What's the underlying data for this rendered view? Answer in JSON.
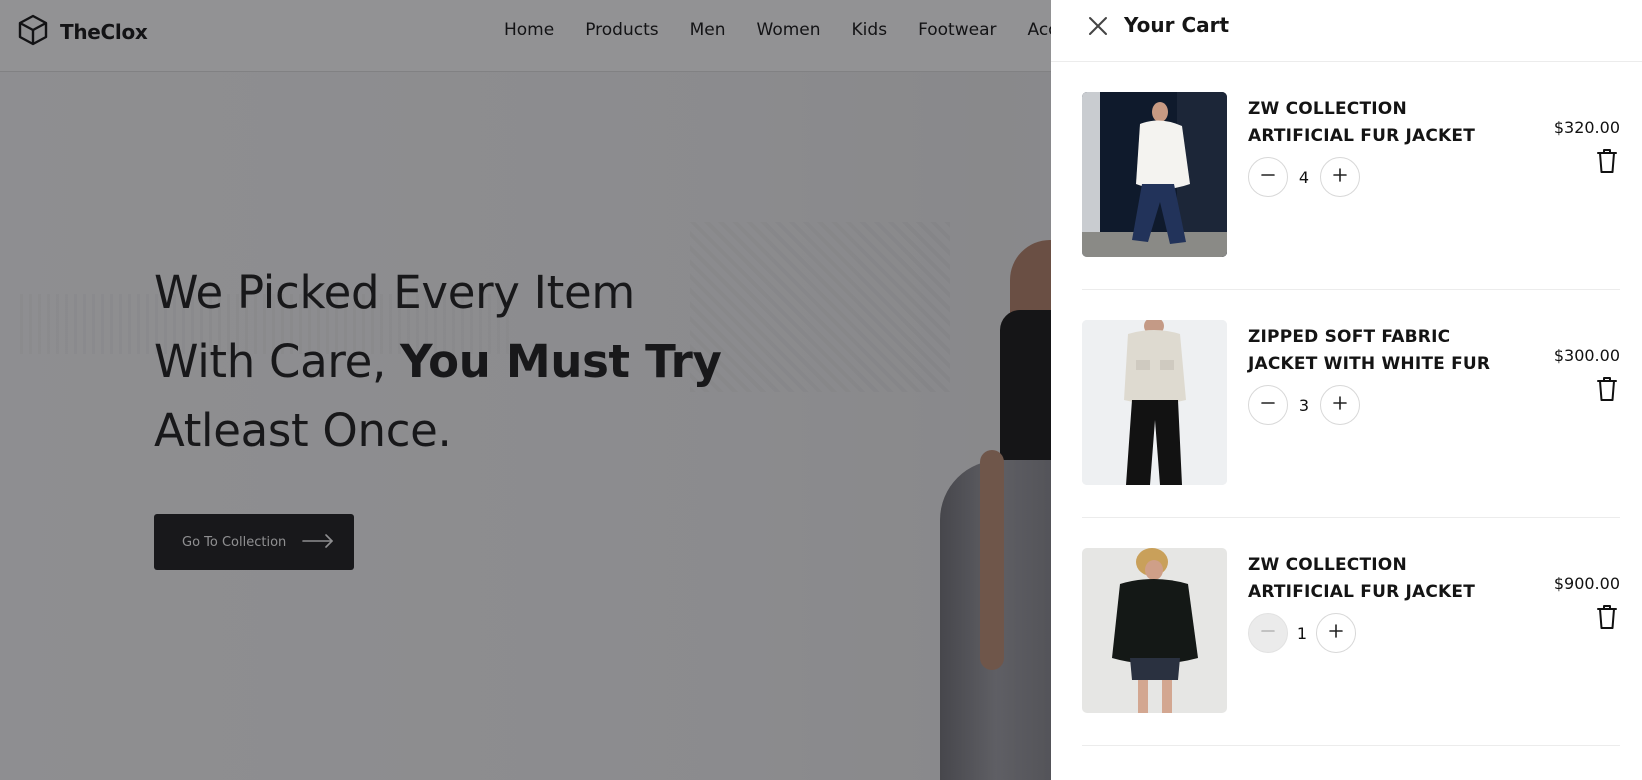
{
  "brand": {
    "name": "TheClox",
    "logo_icon": "cube-icon"
  },
  "nav": {
    "items": [
      {
        "label": "Home"
      },
      {
        "label": "Products"
      },
      {
        "label": "Men"
      },
      {
        "label": "Women"
      },
      {
        "label": "Kids"
      },
      {
        "label": "Footwear"
      },
      {
        "label": "Acc"
      }
    ]
  },
  "hero": {
    "title_line1": "We Picked Every Item",
    "title_line2_regular": "With Care, ",
    "title_line2_bold": "You Must Try",
    "title_line3": "Atleast Once.",
    "cta_label": "Go To Collection",
    "cta_icon": "arrow-right-icon"
  },
  "cart": {
    "title": "Your Cart",
    "close_icon": "close-icon",
    "items": [
      {
        "name": "ZW COLLECTION ARTIFICIAL FUR JACKET",
        "quantity": "4",
        "price": "$320.00",
        "minus_enabled": true
      },
      {
        "name": "ZIPPED SOFT FABRIC JACKET WITH WHITE FUR",
        "quantity": "3",
        "price": "$300.00",
        "minus_enabled": true
      },
      {
        "name": "ZW COLLECTION ARTIFICIAL FUR JACKET",
        "quantity": "1",
        "price": "$900.00",
        "minus_enabled": false
      }
    ]
  },
  "colors": {
    "overlay": "#16161a",
    "button_dark": "#1a1a1c",
    "drawer_bg": "#ffffff",
    "text": "#141414"
  }
}
